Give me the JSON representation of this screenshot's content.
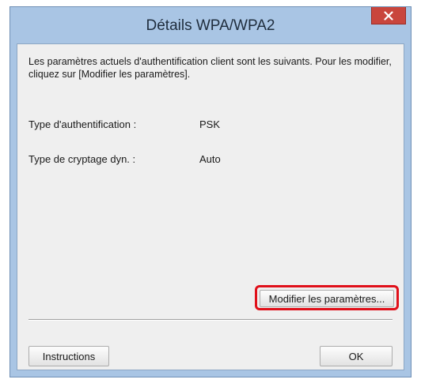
{
  "window": {
    "title": "Détails WPA/WPA2"
  },
  "content": {
    "description": "Les paramètres actuels d'authentification client sont les suivants. Pour les modifier, cliquez sur [Modifier les paramètres].",
    "rows": [
      {
        "label": "Type d'authentification :",
        "value": "PSK"
      },
      {
        "label": "Type de cryptage dyn. :",
        "value": "Auto"
      }
    ]
  },
  "buttons": {
    "modify_settings": "Modifier les paramètres...",
    "instructions": "Instructions",
    "ok": "OK"
  },
  "icons": {
    "close": "close-icon"
  },
  "colors": {
    "titlebar": "#a9c5e4",
    "close_button": "#c9463d",
    "highlight": "#e0101a",
    "panel": "#efefef"
  }
}
